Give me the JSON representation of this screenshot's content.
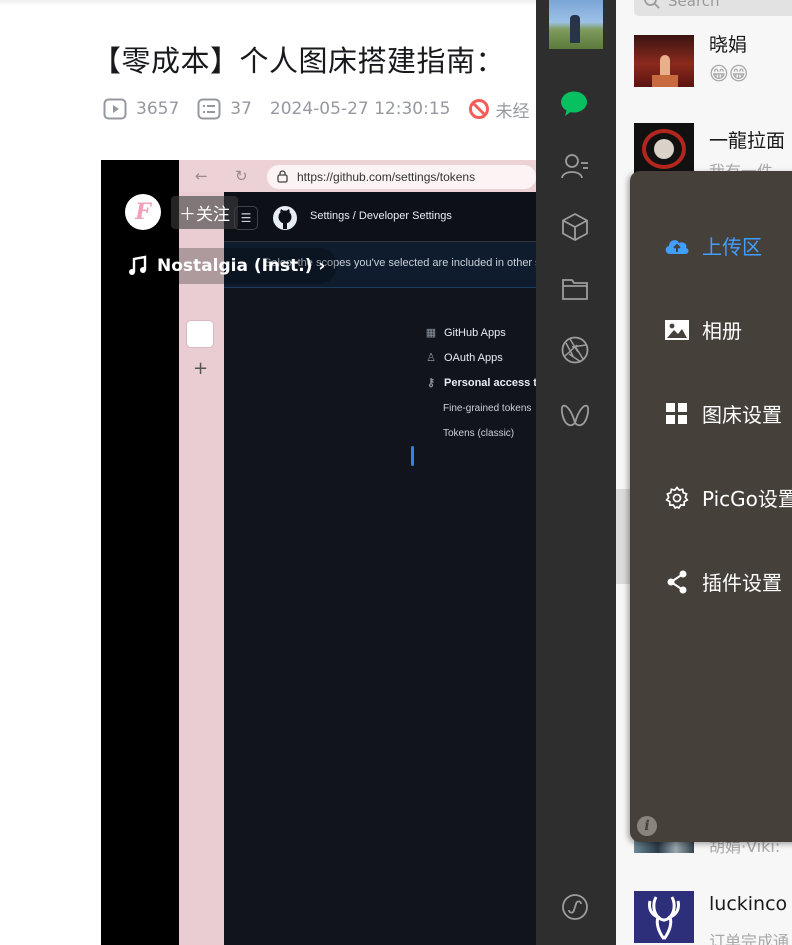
{
  "article": {
    "title": "【零成本】个人图床搭建指南：",
    "views": "3657",
    "comments": "37",
    "date": "2024-05-27 12:30:15",
    "notice": "未经"
  },
  "video": {
    "browser_url": "https://github.com/settings/tokens",
    "breadcrumb": "Settings  /  Developer Settings",
    "banner": "Select the scopes you've selected are included in other scop",
    "nav": [
      "GitHub Apps",
      "OAuth Apps",
      "Personal access to"
    ],
    "subnav": [
      "Fine-grained tokens",
      "Tokens (classic)"
    ],
    "follow_label": "＋关注",
    "uploader_initial": "F",
    "music_label": "Nostalgia (Inst.) ›"
  },
  "wechat": {
    "search_placeholder": "Search",
    "chats": [
      {
        "name": "晓娟",
        "message": "😁😁"
      },
      {
        "name": "一龍拉面",
        "message": "我有一件…"
      },
      {
        "name": "",
        "message": "胡娟·Viki:"
      },
      {
        "name": "luckinco",
        "message": "订单完成通"
      }
    ]
  },
  "picgo": {
    "menu": [
      {
        "label": "上传区",
        "icon": "cloud-upload-icon",
        "active": true
      },
      {
        "label": "相册",
        "icon": "image-icon",
        "active": false
      },
      {
        "label": "图床设置",
        "icon": "grid-icon",
        "active": false
      },
      {
        "label": "PicGo设置",
        "icon": "gear-icon",
        "active": false
      },
      {
        "label": "插件设置",
        "icon": "share-icon",
        "active": false
      }
    ],
    "info_icon_label": "i",
    "accent_color": "#409eff"
  }
}
